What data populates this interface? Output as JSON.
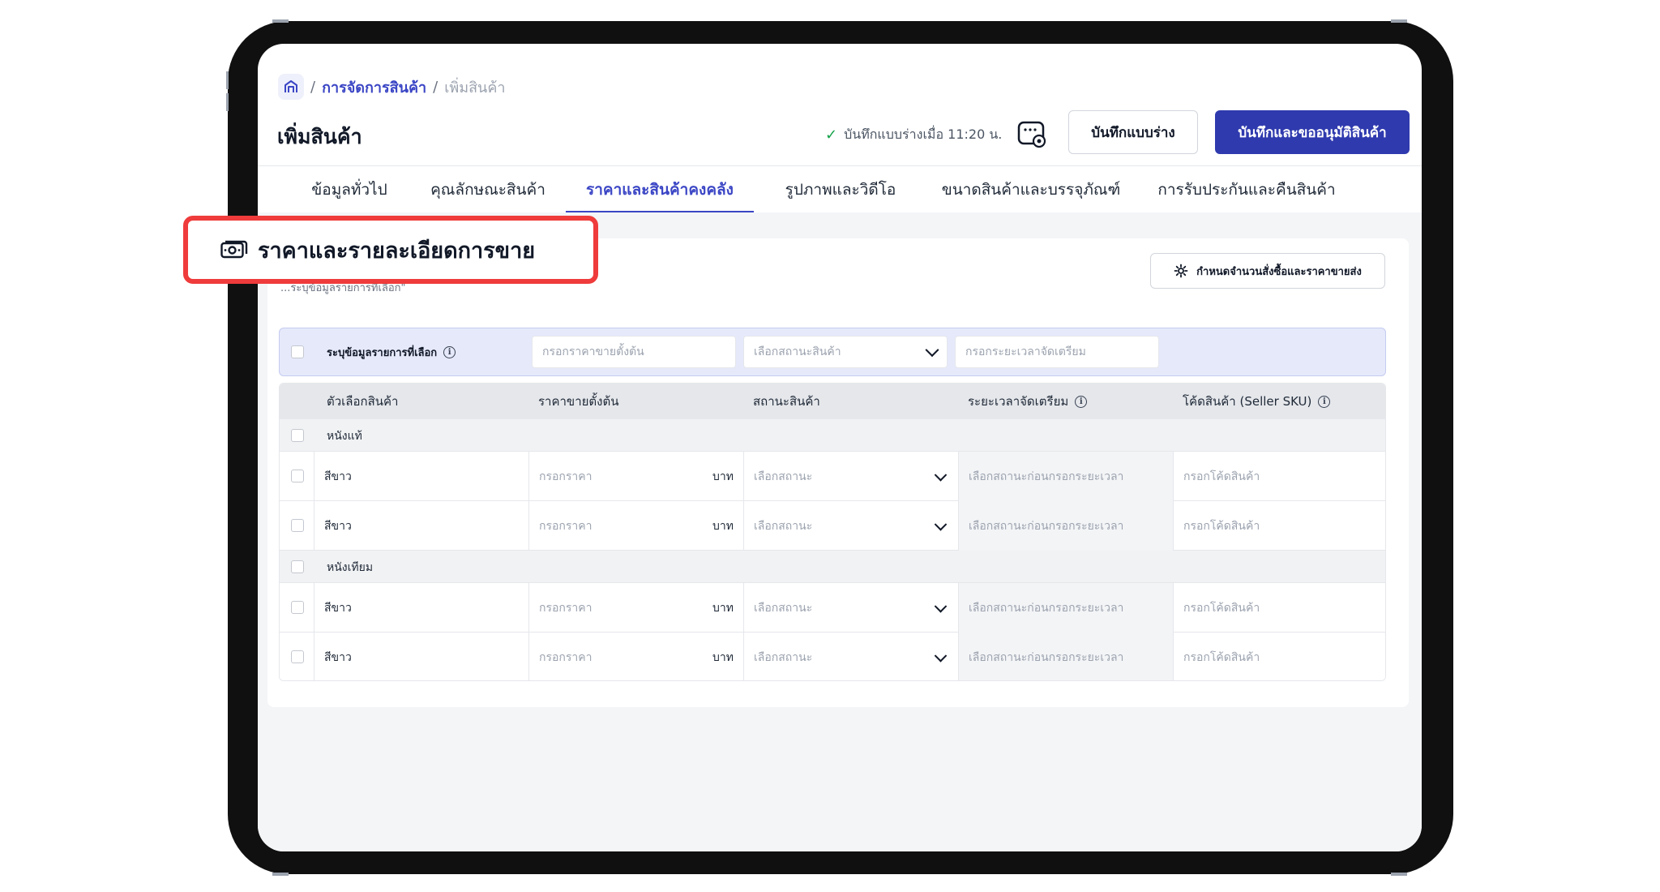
{
  "breadcrumb": {
    "separator": "/",
    "link": "การจัดการสินค้า",
    "current": "เพิ่มสินค้า"
  },
  "header": {
    "title": "เพิ่มสินค้า",
    "save_status": "บันทึกแบบร่างเมื่อ 11:20 น.",
    "draft_button": "บันทึกแบบร่าง",
    "submit_button": "บันทึกและขออนุมัติสินค้า"
  },
  "tabs": [
    {
      "label": "ข้อมูลทั่วไป"
    },
    {
      "label": "คุณลักษณะสินค้า"
    },
    {
      "label": "ราคาและสินค้าคงคลัง"
    },
    {
      "label": "รูปภาพและวิดีโอ"
    },
    {
      "label": "ขนาดสินค้าและบรรจุภัณฑ์"
    },
    {
      "label": "การรับประกันและคืนสินค้า"
    }
  ],
  "active_tab_index": 2,
  "section": {
    "title": "ราคาและรายละเอียดการขาย",
    "hint": "...ระบุข้อมูลรายการที่เลือก\"",
    "bulk_settings_button": "กำหนดจำนวนสั่งซื้อและราคาขายส่ง"
  },
  "bulk_bar": {
    "label": "ระบุข้อมูลรายการที่เลือก",
    "price_placeholder": "กรอกราคาขายตั้งต้น",
    "status_placeholder": "เลือกสถานะสินค้า",
    "lead_time_placeholder": "กรอกระยะเวลาจัดเตรียม"
  },
  "table": {
    "columns": [
      "ตัวเลือกสินค้า",
      "ราคาขายตั้งต้น",
      "สถานะสินค้า",
      "ระยะเวลาจัดเตรียม",
      "โค้ดสินค้า (Seller SKU)"
    ],
    "groups": [
      {
        "name": "หนังแท้",
        "rows": [
          {
            "variant": "สีขาว",
            "price_placeholder": "กรอกราคา",
            "unit": "บาท",
            "status_placeholder": "เลือกสถานะ",
            "lead_placeholder": "เลือกสถานะก่อนกรอกระยะเวลา",
            "sku_placeholder": "กรอกโค้ดสินค้า"
          },
          {
            "variant": "สีขาว",
            "price_placeholder": "กรอกราคา",
            "unit": "บาท",
            "status_placeholder": "เลือกสถานะ",
            "lead_placeholder": "เลือกสถานะก่อนกรอกระยะเวลา",
            "sku_placeholder": "กรอกโค้ดสินค้า"
          }
        ]
      },
      {
        "name": "หนังเทียม",
        "rows": [
          {
            "variant": "สีขาว",
            "price_placeholder": "กรอกราคา",
            "unit": "บาท",
            "status_placeholder": "เลือกสถานะ",
            "lead_placeholder": "เลือกสถานะก่อนกรอกระยะเวลา",
            "sku_placeholder": "กรอกโค้ดสินค้า"
          },
          {
            "variant": "สีขาว",
            "price_placeholder": "กรอกราคา",
            "unit": "บาท",
            "status_placeholder": "เลือกสถานะ",
            "lead_placeholder": "เลือกสถานะก่อนกรอกระยะเวลา",
            "sku_placeholder": "กรอกโค้ดสินค้า"
          }
        ]
      }
    ]
  },
  "colors": {
    "accent": "#3b46c5",
    "primary_button": "#2f3aae",
    "highlight_border": "#ef3b3b",
    "success": "#16a34a"
  },
  "icons": [
    "home-icon",
    "check-icon",
    "preview-icon",
    "money-icon",
    "gear-icon",
    "info-icon",
    "chevron-down-icon"
  ]
}
